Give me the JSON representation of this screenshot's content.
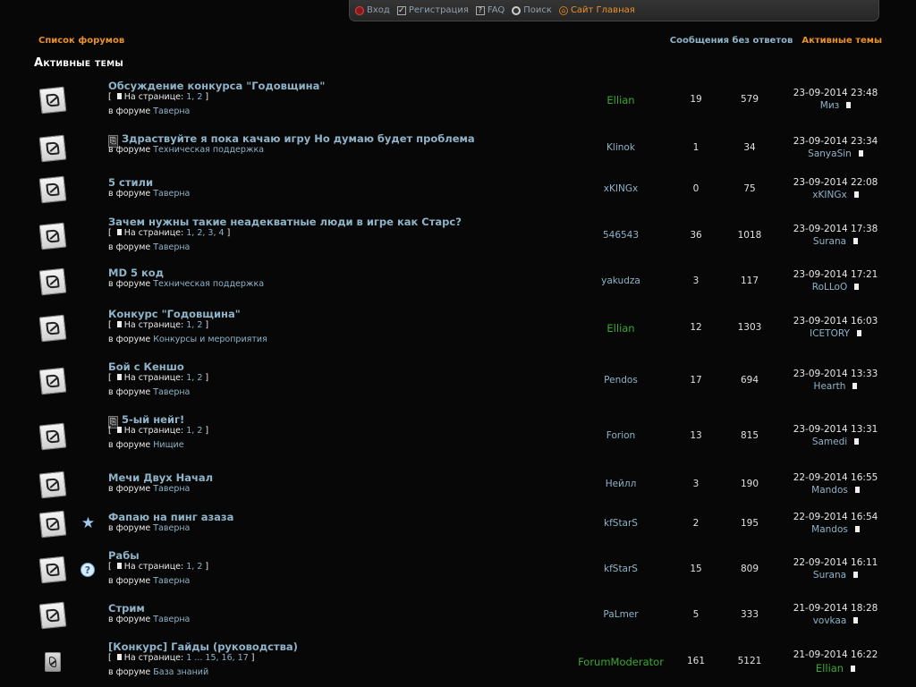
{
  "navbar": {
    "items": [
      {
        "label": "Вход",
        "icon": "login-icon"
      },
      {
        "label": "Регистрация",
        "icon": "register-icon"
      },
      {
        "label": "FAQ",
        "icon": "faq-icon"
      },
      {
        "label": "Поиск",
        "icon": "search-icon"
      },
      {
        "label": "Сайт Главная",
        "icon": "home-icon"
      }
    ]
  },
  "header": {
    "forum_list": "Список форумов",
    "unanswered": "Сообщения без ответов",
    "active": "Активные темы",
    "page_title": "Активные темы"
  },
  "labels": {
    "in_forum": "в форуме",
    "on_page": "На странице:"
  },
  "topics": [
    {
      "title": "Обсуждение конкурса \"Годовщина\"",
      "pages": "1, 2",
      "forum": "Таверна",
      "author": "Ellian",
      "author_green": true,
      "replies": "19",
      "views": "579",
      "last_date": "23-09-2014 23:48",
      "last_user": "Миз",
      "last_green": false
    },
    {
      "title": "Здраствуйте я пока качаю игру Но думаю будет проблема",
      "attach": true,
      "forum": "Техническая поддержка",
      "author": "Klinok",
      "replies": "1",
      "views": "34",
      "last_date": "23-09-2014 23:34",
      "last_user": "SanyaSin"
    },
    {
      "title": "5 стили",
      "forum": "Таверна",
      "author": "xKINGx",
      "replies": "0",
      "views": "75",
      "last_date": "23-09-2014 22:08",
      "last_user": "xKINGx"
    },
    {
      "title": "Зачем нужны такие неадекватные люди в игре как Старс?",
      "pages": "1, 2, 3, 4",
      "forum": "Таверна",
      "author": "546543",
      "replies": "36",
      "views": "1018",
      "last_date": "23-09-2014 17:38",
      "last_user": "Surana"
    },
    {
      "title": "MD 5 код",
      "forum": "Техническая поддержка",
      "author": "yakudza",
      "replies": "3",
      "views": "117",
      "last_date": "23-09-2014 17:21",
      "last_user": "RoLLoO"
    },
    {
      "title": "Конкурс \"Годовщина\"",
      "pages": "1, 2",
      "forum": "Конкурсы и мероприятия",
      "author": "Ellian",
      "author_green": true,
      "replies": "12",
      "views": "1303",
      "last_date": "23-09-2014 16:03",
      "last_user": "ICETORY"
    },
    {
      "title": "Бой с Кеншо",
      "pages": "1, 2",
      "forum": "Таверна",
      "author": "Pendos",
      "replies": "17",
      "views": "694",
      "last_date": "23-09-2014 13:33",
      "last_user": "Hearth"
    },
    {
      "title": "5-ый нейг!",
      "attach": true,
      "pages": "1, 2",
      "forum": "Нищие",
      "author": "Forion",
      "replies": "13",
      "views": "815",
      "last_date": "23-09-2014 13:31",
      "last_user": "Samedi"
    },
    {
      "title": "Мечи Двух Начал",
      "forum": "Таверна",
      "author": "Нейлл",
      "replies": "3",
      "views": "190",
      "last_date": "22-09-2014 16:55",
      "last_user": "Mandos"
    },
    {
      "title": "Фапаю на пинг азаза",
      "status": "star",
      "forum": "Таверна",
      "author": "kfStarS",
      "replies": "2",
      "views": "195",
      "last_date": "22-09-2014 16:54",
      "last_user": "Mandos"
    },
    {
      "title": "Рабы",
      "status": "question",
      "pages": "1, 2",
      "forum": "Таверна",
      "author": "kfStarS",
      "replies": "15",
      "views": "809",
      "last_date": "22-09-2014 16:11",
      "last_user": "Surana"
    },
    {
      "title": "Стрим",
      "forum": "Таверна",
      "author": "PaLmer",
      "replies": "5",
      "views": "333",
      "last_date": "21-09-2014 18:28",
      "last_user": "vovkaa"
    },
    {
      "title": "[Конкурс] Гайды (руководства)",
      "small_icon": true,
      "pages": "1 ... 15, 16, 17",
      "forum": "База знаний",
      "author": "ForumModerator",
      "author_green": true,
      "replies": "161",
      "views": "5121",
      "last_date": "21-09-2014 16:22",
      "last_user": "Ellian",
      "last_green": true
    }
  ],
  "colors": {
    "background": "#070707",
    "link": "#8fb3c8",
    "accent": "#e9912b",
    "moderator_green": "#3aa832"
  }
}
